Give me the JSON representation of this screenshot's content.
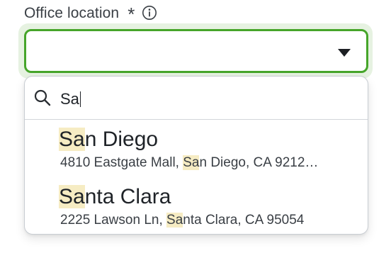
{
  "field": {
    "label": "Office location",
    "required_mark": "*",
    "info_icon": "info-icon",
    "selected_value": ""
  },
  "colors": {
    "focus_border": "#46a52a",
    "focus_ring": "#e6f2e1",
    "highlight": "#f6ecc3"
  },
  "search": {
    "icon": "search-icon",
    "value": "Sa"
  },
  "options": [
    {
      "title_match": "Sa",
      "title_rest": "n Diego",
      "addr_pre": "4810 Eastgate Mall, ",
      "addr_match": "Sa",
      "addr_rest": "n Diego, CA 9212…"
    },
    {
      "title_match": "Sa",
      "title_rest": "nta Clara",
      "addr_pre": "2225 Lawson Ln, ",
      "addr_match": "Sa",
      "addr_rest": "nta Clara, CA 95054"
    }
  ]
}
